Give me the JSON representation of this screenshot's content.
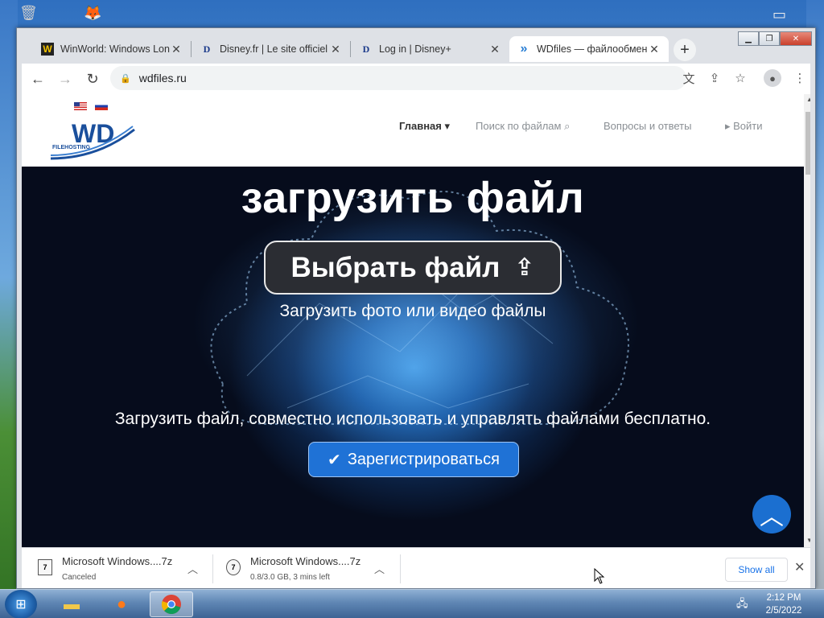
{
  "browser": {
    "tabs": [
      {
        "favicon": "W",
        "title": "WinWorld: Windows Lon",
        "active": false
      },
      {
        "favicon": "D",
        "title": "Disney.fr | Le site officiel",
        "active": false
      },
      {
        "favicon": "D",
        "title": "Log in | Disney+",
        "active": false
      },
      {
        "favicon": "»",
        "title": "WDfiles — файлообмен",
        "active": true
      }
    ],
    "newtab_glyph": "+",
    "url": "wdfiles.ru",
    "lock_glyph": "🔒"
  },
  "site": {
    "logo_text": "WD",
    "logo_sub": "FILEHOSTING",
    "nav": [
      {
        "label": "Главная ▾",
        "active": true
      },
      {
        "label": "Поиск по файлам ⌕",
        "active": false
      },
      {
        "label": "Вопросы и ответы",
        "active": false
      },
      {
        "label": "▸ Войти",
        "active": false
      }
    ]
  },
  "hero": {
    "title": "загрузить файл",
    "choose_label": "Выбрать файл",
    "subtitle": "Загрузить фото или видео файлы",
    "description": "Загрузить файл, совместно использовать и управлять файлами бесплатно.",
    "register_label": "Зарегистрироваться"
  },
  "downloads": {
    "items": [
      {
        "name": "Microsoft Windows....7z",
        "status": "Canceled"
      },
      {
        "name": "Microsoft Windows....7z",
        "status": "0.8/3.0 GB, 3 mins left"
      }
    ],
    "show_all": "Show all"
  },
  "taskbar": {
    "time": "2:12 PM",
    "date": "2/5/2022"
  },
  "colors": {
    "accent": "#1f72d6",
    "logo_blue": "#1a4f9c"
  }
}
